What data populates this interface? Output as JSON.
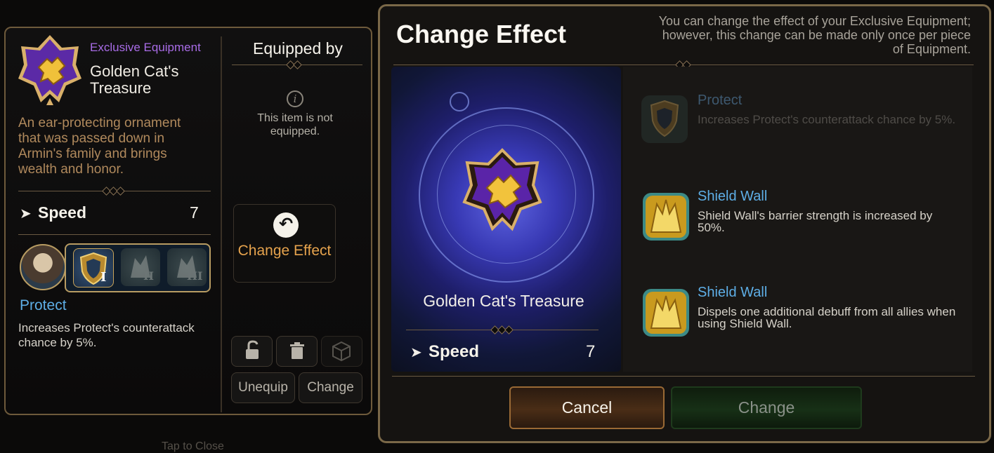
{
  "item_detail": {
    "category": "Exclusive Equipment",
    "name": "Golden Cat's Treasure",
    "description": "An ear-protecting ornament that was passed down in Armin's family and brings wealth and honor.",
    "stat": {
      "label": "Speed",
      "value": "7"
    },
    "skill_tiers": [
      "I",
      "II",
      "III"
    ],
    "selected_tier": 1,
    "skill": {
      "name": "Protect",
      "description": "Increases Protect's counterattack chance by 5%."
    }
  },
  "equipped_by": {
    "title": "Equipped by",
    "status_text": "This item is not equipped.",
    "info_icon": "i"
  },
  "actions": {
    "change_effect_label": "Change Effect",
    "unequip_label": "Unequip",
    "change_label": "Change"
  },
  "footer": {
    "tap_to_close": "Tap to Close"
  },
  "dialog": {
    "title": "Change Effect",
    "help_text": "You can change the effect of your Exclusive Equipment; however, this change can be made only once per piece of Equipment.",
    "item_name": "Golden Cat's Treasure",
    "stat": {
      "label": "Speed",
      "value": "7"
    },
    "effects": [
      {
        "title": "Protect",
        "description": "Increases Protect's counterattack chance by 5%.",
        "state": "current"
      },
      {
        "title": "Shield Wall",
        "description": "Shield Wall's barrier strength is increased by 50%.",
        "state": "option"
      },
      {
        "title": "Shield Wall",
        "description": "Dispels one additional debuff from all allies when using Shield Wall.",
        "state": "option"
      }
    ],
    "cancel_label": "Cancel",
    "change_label": "Change"
  },
  "colors": {
    "category_purple": "#a86ce6",
    "description_brown": "#b0895c",
    "skill_blue": "#5eaee6",
    "accent_orange": "#e6a34d",
    "frame_gold": "#7a6848"
  }
}
